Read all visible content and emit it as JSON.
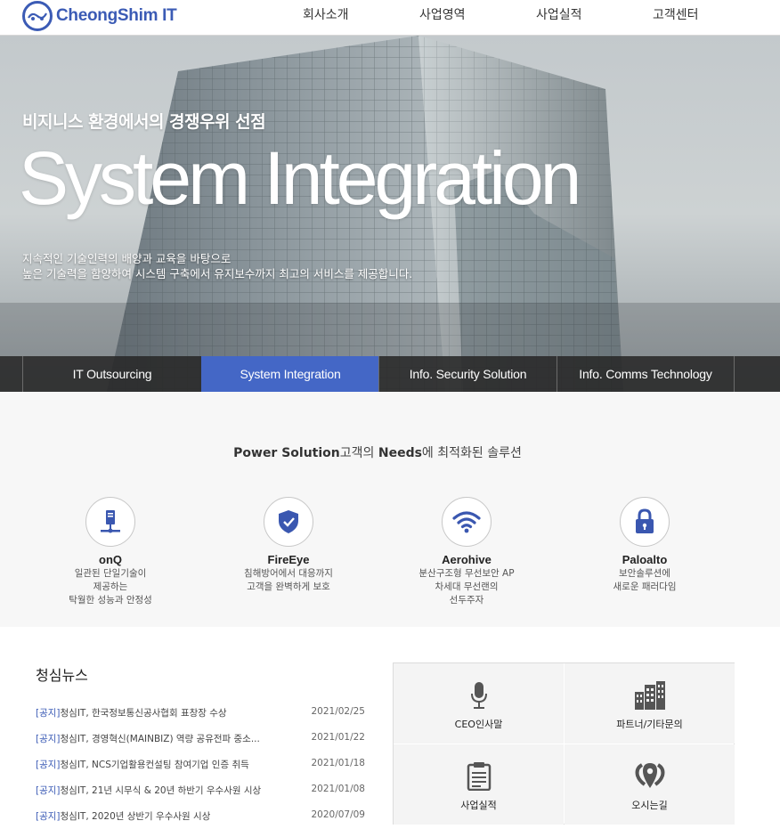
{
  "header": {
    "logo_text": "CheongShim IT",
    "nav": [
      "회사소개",
      "사업영역",
      "사업실적",
      "고객센터"
    ]
  },
  "hero": {
    "subtitle": "비지니스 환경에서의 경쟁우위 선점",
    "title": "System Integration",
    "desc_line1": "지속적인 기술인력의 배양과 교육을 바탕으로",
    "desc_line2": "높은 기술력을 함양하여 시스템 구축에서 유지보수까지 최고의 서비스를 제공합니다."
  },
  "tabs": [
    "IT Outsourcing",
    "System Integration",
    "Info. Security Solution",
    "Info. Comms Technology"
  ],
  "tabs_active": "System Integration",
  "solutions": {
    "heading_bold1": "Power Solution",
    "heading_mid": "고객의 ",
    "heading_bold2": "Needs",
    "heading_end": "에 최적화된 솔루션",
    "items": [
      {
        "name": "onQ",
        "desc": [
          "일관된 단일기술이",
          "제공하는",
          "탁월한 성능과 안정성"
        ],
        "icon": "server-icon"
      },
      {
        "name": "FireEye",
        "desc": [
          "침해방어에서 대응까지",
          "고객을 완벽하게 보호"
        ],
        "icon": "shield-check-icon"
      },
      {
        "name": "Aerohive",
        "desc": [
          "분산구조형 무선보안 AP",
          "차세대 무선랜의",
          "선두주자"
        ],
        "icon": "wifi-icon"
      },
      {
        "name": "Paloalto",
        "desc": [
          "보안솔루션에",
          "새로운 패러다임"
        ],
        "icon": "lock-icon"
      }
    ]
  },
  "news": {
    "title": "청심뉴스",
    "items": [
      {
        "tag": "[공지]",
        "text": "청심IT, 한국정보통신공사협회 표창장 수상",
        "date": "2021/02/25"
      },
      {
        "tag": "[공지]",
        "text": "청심IT, 경영혁신(MAINBIZ) 역량 공유전파 중소...",
        "date": "2021/01/22"
      },
      {
        "tag": "[공지]",
        "text": "청심IT, NCS기업활용컨설팅 참여기업 인증 취득",
        "date": "2021/01/18"
      },
      {
        "tag": "[공지]",
        "text": "청심IT, 21년 시무식 & 20년 하반기 우수사원 시상",
        "date": "2021/01/08"
      },
      {
        "tag": "[공지]",
        "text": "청심IT, 2020년 상반기 우수사원 시상",
        "date": "2020/07/09"
      }
    ]
  },
  "quick_links": [
    {
      "label": "CEO인사말",
      "icon": "microphone-icon"
    },
    {
      "label": "파트너/기타문의",
      "icon": "buildings-icon"
    },
    {
      "label": "사업실적",
      "icon": "clipboard-icon"
    },
    {
      "label": "오시는길",
      "icon": "map-pin-icon"
    }
  ],
  "colors": {
    "brand": "#3b5bb5",
    "tab_active": "#4467c6",
    "icon_blue": "#3a57b0"
  }
}
